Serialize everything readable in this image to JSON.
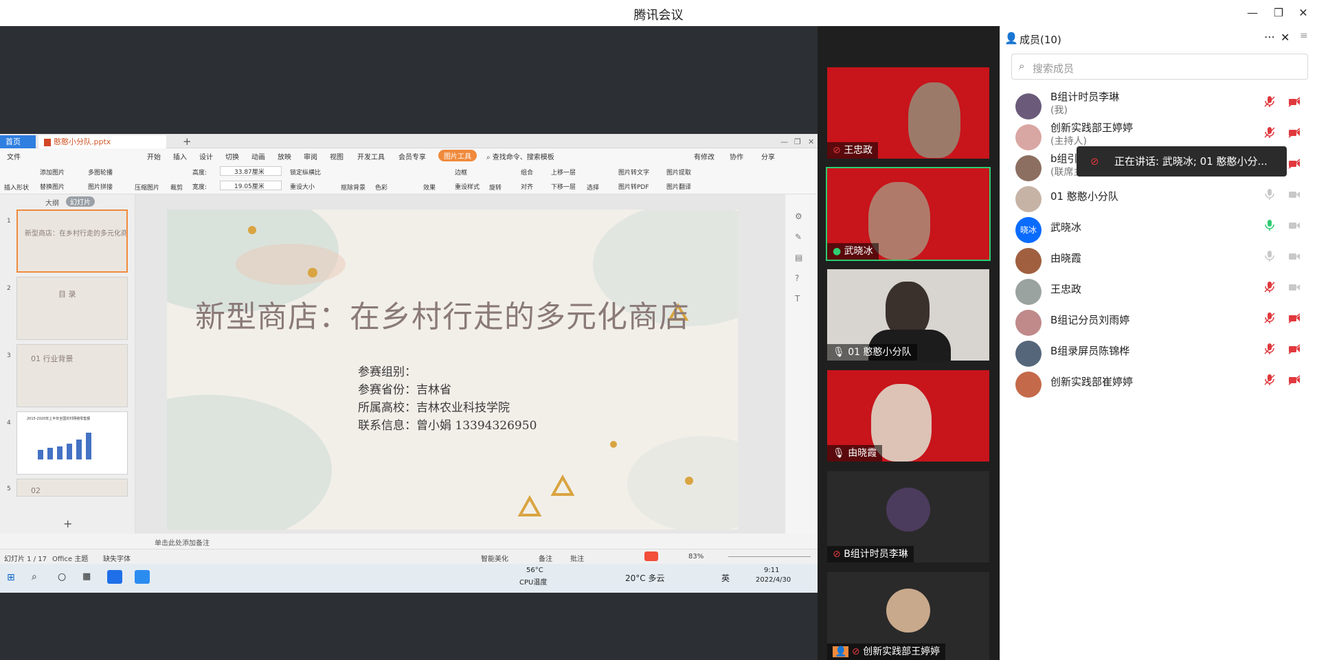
{
  "window": {
    "title": "腾讯会议"
  },
  "wps": {
    "tabs": {
      "home": "首页",
      "doc": "憨憨小分队.pptx"
    },
    "menu": [
      "文件",
      "开始",
      "插入",
      "设计",
      "切换",
      "动画",
      "放映",
      "审阅",
      "视图",
      "开发工具",
      "会员专享",
      "图片工具"
    ],
    "search_placeholder": "查找命令、搜索模板",
    "right_actions": [
      "有修改",
      "协作",
      "分享"
    ],
    "ribbon": {
      "insert_shape": "插入形状",
      "add_pic": "添加图片",
      "replace_pic": "替换图片",
      "multi_crop": "多图轮播",
      "pic_stitch": "图片拼接",
      "compress": "压缩图片",
      "crop": "裁剪",
      "height_label": "高度:",
      "height": "33.87厘米",
      "width_label": "宽度:",
      "width": "19.05厘米",
      "lock_ratio": "锁定纵横比",
      "reset_size": "重设大小",
      "remove_bg": "抠除背景",
      "color": "色彩",
      "effect": "效果",
      "border": "边框",
      "reset_style": "重设样式",
      "rotate": "旋转",
      "group": "组合",
      "align": "对齐",
      "up_layer": "上移一层",
      "down_layer": "下移一层",
      "select": "选择",
      "pic_to_text": "图片转文字",
      "pic_extract": "图片提取",
      "pic_to_pdf": "图片转PDF",
      "pic_translate": "图片翻译"
    },
    "pane_tabs": [
      "大纲",
      "幻灯片"
    ],
    "thumbs": [
      {
        "num": "1",
        "title": "新型商店：在乡村行走的多元化商店"
      },
      {
        "num": "2",
        "title": "目 录"
      },
      {
        "num": "3",
        "title": "01 行业背景"
      },
      {
        "num": "4",
        "title": "2015-2020年上半年全国农村网络零售额"
      },
      {
        "num": "5",
        "title": "02"
      }
    ],
    "slide": {
      "title": "新型商店：在乡村行走的多元化商店",
      "info": [
        "参赛组别：",
        "参赛省份：吉林省",
        "所属高校：吉林农业科技学院",
        "联系信息：曾小娟  13394326950"
      ]
    },
    "notes_placeholder": "单击此处添加备注",
    "status": {
      "slide": "幻灯片 1 / 17",
      "theme": "Office 主题",
      "font": "缺失字体",
      "beautify": "智能美化",
      "remarks": "备注",
      "comments": "批注",
      "zoom": "83%"
    },
    "taskbar": {
      "temp": "56°C",
      "cpu": "CPU温度",
      "weather": "20°C 多云",
      "lang": "英",
      "time": "9:11",
      "date": "2022/4/30"
    }
  },
  "videos": [
    {
      "name": "王忠政",
      "bg": "red"
    },
    {
      "name": "武晓冰",
      "bg": "red",
      "active": true
    },
    {
      "name": "01 憨憨小分队",
      "bg": "room"
    },
    {
      "name": "由晓霞",
      "bg": "red"
    },
    {
      "name": "B组计时员李琳",
      "bg": "dark"
    },
    {
      "name": "创新实践部王婷婷",
      "bg": "dark"
    }
  ],
  "members": {
    "title": "成员(10)",
    "search_placeholder": "搜索成员",
    "list": [
      {
        "name": "B组计时员李琳",
        "sub": "(我)",
        "mic": "muted",
        "cam": "off"
      },
      {
        "name": "创新实践部王婷婷",
        "sub": "(主持人)",
        "mic": "muted",
        "cam": "off"
      },
      {
        "name": "b组引导员徐如妍",
        "sub": "(联席主持人)",
        "mic": "muted",
        "cam": "off"
      },
      {
        "name": "01 憨憨小分队",
        "sub": "",
        "mic": "on",
        "cam": "on"
      },
      {
        "name": "武晓冰",
        "sub": "",
        "mic": "speaking",
        "cam": "on",
        "avatar_text": "晓冰"
      },
      {
        "name": "由晓霞",
        "sub": "",
        "mic": "on",
        "cam": "on"
      },
      {
        "name": "王忠政",
        "sub": "",
        "mic": "muted",
        "cam": "on"
      },
      {
        "name": "B组记分员刘雨婷",
        "sub": "",
        "mic": "muted",
        "cam": "off"
      },
      {
        "name": "B组录屏员陈锦桦",
        "sub": "",
        "mic": "muted",
        "cam": "off"
      },
      {
        "name": "创新实践部崔婷婷",
        "sub": "",
        "mic": "muted",
        "cam": "off"
      }
    ]
  },
  "speaking_tooltip": "正在讲话: 武晓冰; 01 憨憨小分...",
  "colors": {
    "accent": "#0a6cff",
    "speaking": "#2ecc71",
    "muted": "#e0393e",
    "wps_orange": "#f08a3c"
  }
}
